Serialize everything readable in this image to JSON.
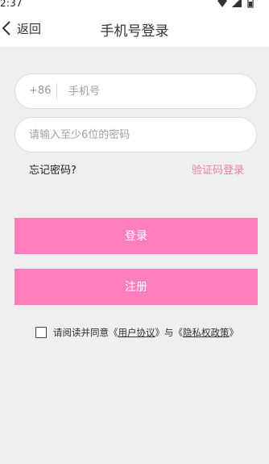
{
  "status": {
    "time": "2:37"
  },
  "nav": {
    "back_label": "返回",
    "title": "手机号登录"
  },
  "phone": {
    "prefix": "+86",
    "placeholder": "手机号"
  },
  "password": {
    "placeholder": "请输入至少6位的密码"
  },
  "links": {
    "forgot": "忘记密码?",
    "code_login": "验证码登录"
  },
  "buttons": {
    "login": "登录",
    "register": "注册"
  },
  "agreement": {
    "prefix": "请阅读并同意《",
    "user_agreement": "用户协议",
    "middle": "》与《",
    "privacy_policy": "隐私权政策",
    "suffix": "》"
  },
  "colors": {
    "accent": "#ff7fbe",
    "link_pink": "#ee7aa8",
    "background": "#efefef"
  }
}
